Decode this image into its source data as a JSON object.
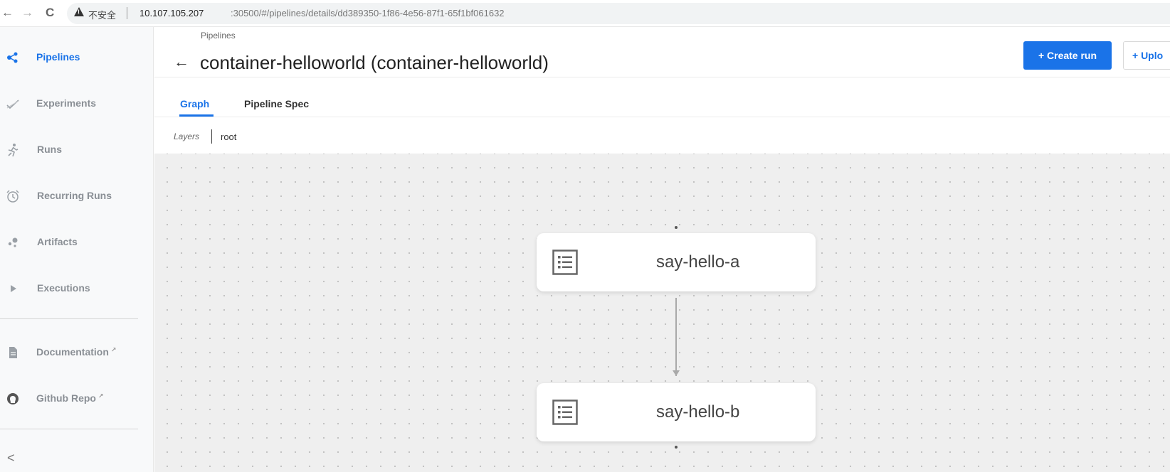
{
  "browser": {
    "back": "←",
    "forward": "→",
    "reload": "C",
    "insecure_label": "不安全",
    "url_host": "10.107.105.207",
    "url_rest": ":30500/#/pipelines/details/dd389350-1f86-4e56-87f1-65f1bf061632"
  },
  "sidebar": {
    "items": [
      {
        "label": "Pipelines",
        "icon": "pipelines-icon",
        "active": true
      },
      {
        "label": "Experiments",
        "icon": "experiments-icon"
      },
      {
        "label": "Runs",
        "icon": "runs-icon"
      },
      {
        "label": "Recurring Runs",
        "icon": "alarm-clock-icon"
      },
      {
        "label": "Artifacts",
        "icon": "artifacts-icon"
      },
      {
        "label": "Executions",
        "icon": "play-icon"
      }
    ],
    "links": [
      {
        "label": "Documentation",
        "icon": "document-icon"
      },
      {
        "label": "Github Repo",
        "icon": "github-icon"
      }
    ],
    "external_mark": "↗",
    "collapse": "<"
  },
  "header": {
    "breadcrumb": "Pipelines",
    "back": "←",
    "title": "container-helloworld (container-helloworld)",
    "create_run": "+ Create run",
    "upload": "+ Uplo"
  },
  "tabs": [
    {
      "label": "Graph",
      "active": true
    },
    {
      "label": "Pipeline Spec"
    }
  ],
  "layers": {
    "label": "Layers",
    "value": "root"
  },
  "graph": {
    "nodes": [
      {
        "label": "say-hello-a",
        "icon": "list-icon"
      },
      {
        "label": "say-hello-b",
        "icon": "list-icon"
      }
    ]
  },
  "colors": {
    "accent": "#1a73e8",
    "canvas": "#efefef",
    "sidebar": "#f8f9fa"
  }
}
